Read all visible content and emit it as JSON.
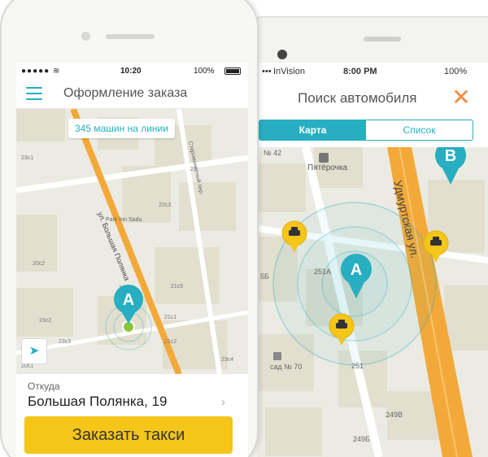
{
  "left_phone": {
    "status": {
      "time": "10:20",
      "battery": "100%"
    },
    "header": {
      "title": "Оформление заказа"
    },
    "map": {
      "cars_badge": "345 машин на линии",
      "pin_label": "A",
      "street_label": "ул. Большая Полянка",
      "side_street": "Старомонетный пер.",
      "poi": "Park Inn Sadu",
      "buildings": [
        "23с1",
        "23с2",
        "23с3",
        "22с3",
        "21с1",
        "21с2",
        "20с2",
        "20с1",
        "19с1",
        "22",
        "21с5",
        "23с4"
      ]
    },
    "address": {
      "label": "Откуда",
      "value": "Большая Полянка, 19"
    },
    "order_button": "Заказать такси"
  },
  "right_phone": {
    "status": {
      "carrier": "InVision",
      "time": "8:00 PM",
      "battery": "100%"
    },
    "header": {
      "title": "Поиск автомобиля"
    },
    "tabs": [
      {
        "label": "Карта",
        "active": true
      },
      {
        "label": "Список",
        "active": false
      }
    ],
    "map": {
      "pin_a": "A",
      "pin_b": "B",
      "street": "Удмуртская ул.",
      "poi": "Пятёрочка",
      "labels": [
        "№ 42",
        "251А",
        "5Б",
        "сад № 70",
        "251",
        "249В",
        "249Б"
      ]
    }
  },
  "colors": {
    "accent": "#27aec0",
    "order_button": "#f5c518",
    "close": "#f28a3c",
    "road": "#f3a939",
    "map_bg": "#ecebe3"
  }
}
